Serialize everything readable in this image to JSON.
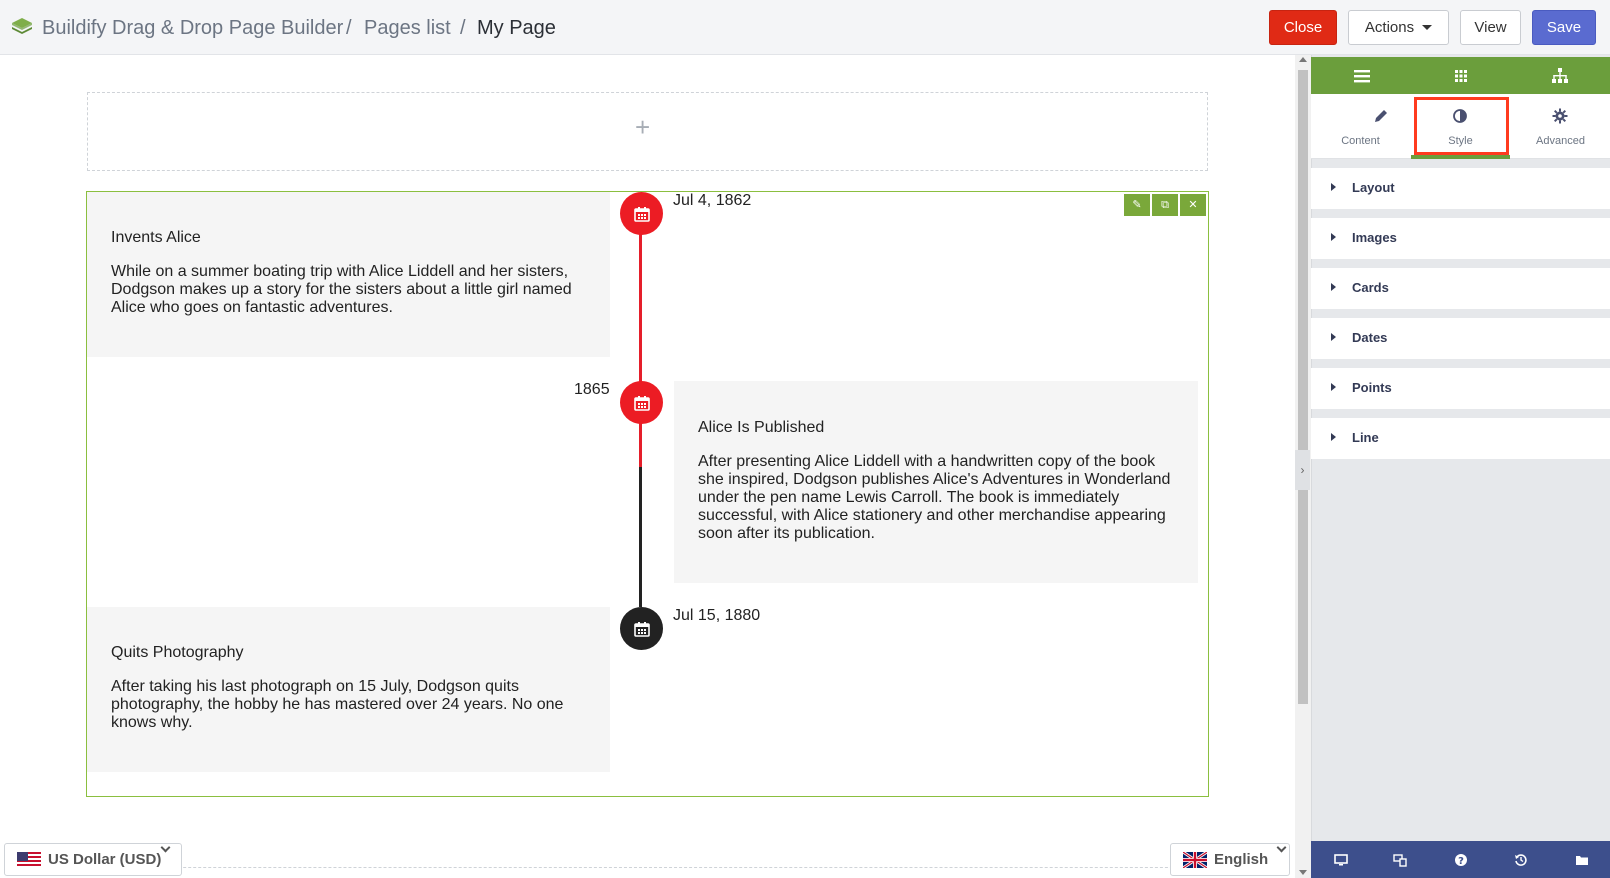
{
  "breadcrumb": {
    "app": "Buildify Drag & Drop Page Builder",
    "sep1": "/",
    "pages": "Pages list",
    "sep2": "/",
    "current": "My Page"
  },
  "toolbar": {
    "close_label": "Close",
    "actions_label": "Actions",
    "view_label": "View",
    "save_label": "Save"
  },
  "canvas": {
    "add_section_symbol": "+"
  },
  "timeline": {
    "items": [
      {
        "date": "Jul 4, 1862",
        "title": "Invents Alice",
        "text": "While on a summer boating trip with Alice Liddell and her sisters, Dodgson makes up a story for the sisters about a little girl named Alice who goes on fantastic adventures."
      },
      {
        "date": "1865",
        "title": "Alice Is Published",
        "text": "After presenting Alice Liddell with a handwritten copy of the book she inspired, Dodgson publishes Alice's Adventures in Wonderland under the pen name Lewis Carroll. The book is immediately successful, with Alice stationery and other merchandise appearing soon after its publication."
      },
      {
        "date": "Jul 15, 1880",
        "title": "Quits Photography",
        "text": "After taking his last photograph on 15 July, Dodgson quits photography, the hobby he has mastered over 24 years. No one knows why."
      }
    ]
  },
  "footer": {
    "currency_label": "US Dollar (USD)",
    "language_label": "English"
  },
  "panel": {
    "tabs": [
      {
        "label": "Content",
        "icon": "pencil-icon"
      },
      {
        "label": "Style",
        "icon": "contrast-icon"
      },
      {
        "label": "Advanced",
        "icon": "gear-icon"
      }
    ],
    "active_tab": "Style",
    "sections": [
      "Layout",
      "Images",
      "Cards",
      "Dates",
      "Points",
      "Line"
    ]
  },
  "colors": {
    "accent_green": "#6b9e3c",
    "close_red": "#e02a15",
    "save_blue": "#5a6bd0",
    "timeline_red": "#ec1c24",
    "timeline_dark": "#222222",
    "panel_footer": "#3d4f8c",
    "highlight": "#ff3b1f"
  }
}
